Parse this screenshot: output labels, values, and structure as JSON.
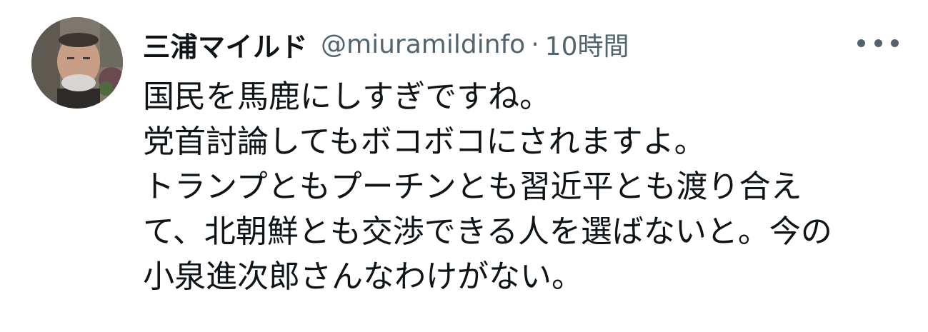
{
  "tweet": {
    "display_name": "三浦マイルド",
    "handle": "@miuramildinfo",
    "separator": "·",
    "time": "10時間",
    "more_icon": "more-horizontal-icon",
    "text_lines": [
      "国民を馬鹿にしすぎですね。",
      "党首討論してもボコボコにされますよ。",
      "トランプともプーチンとも習近平とも渡り合え",
      "て、北朝鮮とも交渉できる人を選ばないと。今の",
      "小泉進次郎さんなわけがない。"
    ]
  },
  "colors": {
    "text_primary": "#0f1419",
    "text_secondary": "#536471"
  }
}
